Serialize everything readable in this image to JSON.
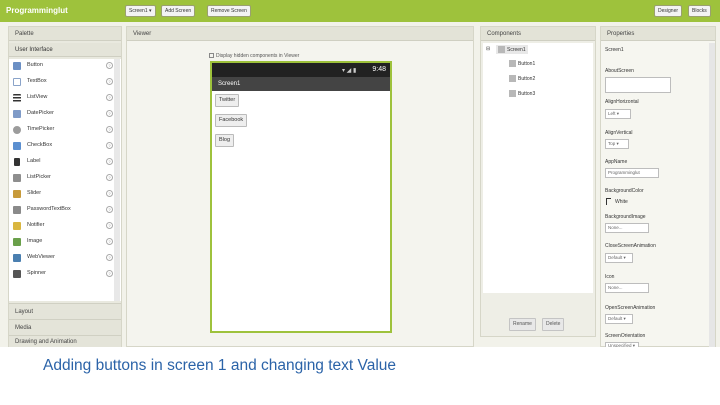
{
  "app": {
    "title": "Programminglut"
  },
  "toolbar": {
    "screen_select": "Screen1 ▾",
    "add_screen": "Add Screen",
    "remove_screen": "Remove Screen",
    "designer": "Designer",
    "blocks": "Blocks"
  },
  "palette": {
    "title": "Palette",
    "section": "User Interface",
    "items": [
      {
        "label": "Button",
        "icon": "button-icon",
        "color": "#6b8fc4"
      },
      {
        "label": "TextBox",
        "icon": "textbox-icon",
        "color": "#8aa3c9"
      },
      {
        "label": "ListView",
        "icon": "listview-icon",
        "color": "#333333"
      },
      {
        "label": "DatePicker",
        "icon": "datepicker-icon",
        "color": "#7f9bc8"
      },
      {
        "label": "TimePicker",
        "icon": "timepicker-icon",
        "color": "#9c9c9c"
      },
      {
        "label": "CheckBox",
        "icon": "checkbox-icon",
        "color": "#5b8fd0"
      },
      {
        "label": "Label",
        "icon": "label-icon",
        "color": "#333333"
      },
      {
        "label": "ListPicker",
        "icon": "listpicker-icon",
        "color": "#8e8e8e"
      },
      {
        "label": "Slider",
        "icon": "slider-icon",
        "color": "#c79a3a"
      },
      {
        "label": "PasswordTextBox",
        "icon": "password-icon",
        "color": "#8a8a8a"
      },
      {
        "label": "Notifier",
        "icon": "notifier-icon",
        "color": "#d9b640"
      },
      {
        "label": "Image",
        "icon": "image-icon",
        "color": "#6aa04a"
      },
      {
        "label": "WebViewer",
        "icon": "webviewer-icon",
        "color": "#4a7fb0"
      },
      {
        "label": "Spinner",
        "icon": "spinner-icon",
        "color": "#555555"
      }
    ],
    "help": "?",
    "sections": [
      "Layout",
      "Media",
      "Drawing and Animation"
    ]
  },
  "viewer": {
    "title": "Viewer",
    "checkbox_label": "Display hidden components in Viewer",
    "clock": "9:48",
    "status_icons": "▾ ◢ ▮",
    "screen_title": "Screen1",
    "buttons": [
      "Twitter",
      "Facebook",
      "Blog"
    ]
  },
  "components": {
    "title": "Components",
    "root": "Screen1",
    "children": [
      "Button1",
      "Button2",
      "Button3"
    ],
    "collapse": "⊟",
    "rename": "Rename",
    "delete": "Delete"
  },
  "properties": {
    "title": "Properties",
    "component": "Screen1",
    "rows": [
      {
        "label": "AboutScreen",
        "value": ""
      },
      {
        "label": "AlignHorizontal",
        "value": "Left ▾"
      },
      {
        "label": "AlignVertical",
        "value": "Top ▾"
      },
      {
        "label": "AppName",
        "value": "Programminglut"
      },
      {
        "label": "BackgroundColor",
        "value": "White"
      },
      {
        "label": "BackgroundImage",
        "value": "None..."
      },
      {
        "label": "CloseScreenAnimation",
        "value": "Default ▾"
      },
      {
        "label": "Icon",
        "value": "None..."
      },
      {
        "label": "OpenScreenAnimation",
        "value": "Default ▾"
      },
      {
        "label": "ScreenOrientation",
        "value": "Unspecified ▾"
      }
    ]
  },
  "caption": "Adding buttons in screen 1 and changing text Value",
  "colors": {
    "accent": "#9ec23c",
    "caption": "#2b63a8"
  }
}
